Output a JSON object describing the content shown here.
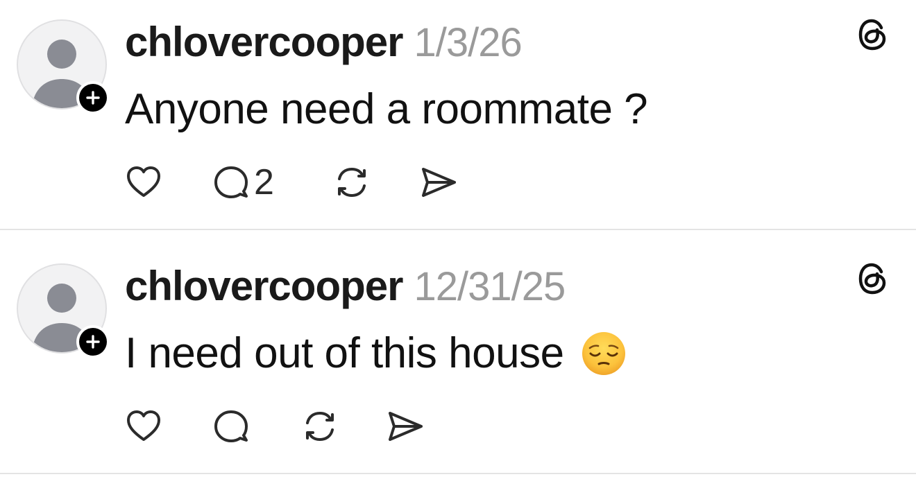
{
  "posts": [
    {
      "username": "chlovercooper",
      "timestamp": "1/3/26",
      "text": "Anyone need a roommate ?",
      "emoji": "",
      "reply_count": "2"
    },
    {
      "username": "chlovercooper",
      "timestamp": "12/31/25",
      "text": "I need out of this house",
      "emoji": "pensive-face-emoji",
      "reply_count": ""
    }
  ],
  "icons": {
    "avatar": "default-avatar-icon",
    "follow": "plus-icon",
    "like": "heart-icon",
    "reply": "comment-icon",
    "repost": "repost-icon",
    "share": "send-icon",
    "brand": "threads-logo-icon"
  },
  "colors": {
    "timestamp": "#9a9a9a",
    "icon_stroke": "#2b2b2b",
    "avatar_silhouette": "#8a8c94",
    "divider": "#e4e4e4"
  }
}
